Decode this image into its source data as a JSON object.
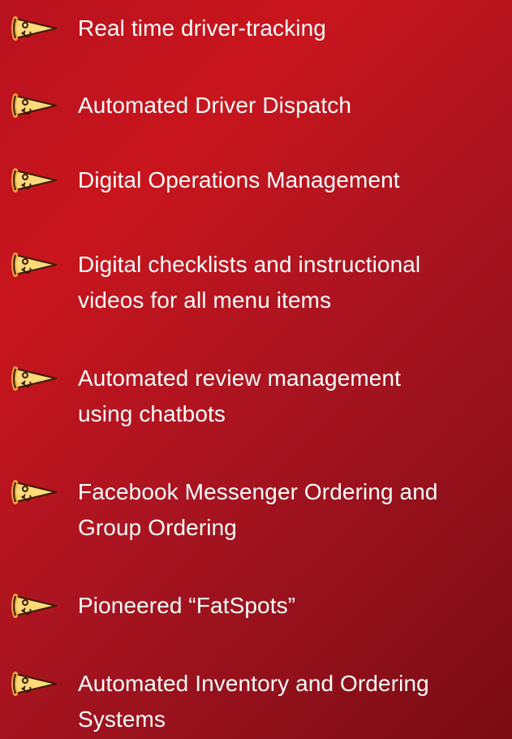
{
  "icon_name": "pizza-slice-icon",
  "colors": {
    "background_start": "#b8121f",
    "background_end": "#7a0c14",
    "text": "#ffffff",
    "icon_crust": "#f2a53a",
    "icon_cheese": "#ffd97a",
    "icon_outline": "#3a1a00"
  },
  "features": [
    {
      "lines": [
        "Real time driver-tracking"
      ]
    },
    {
      "lines": [
        "Automated Driver Dispatch"
      ]
    },
    {
      "lines": [
        "Digital Operations Management"
      ]
    },
    {
      "lines": [
        "Digital checklists and instructional",
        "videos for all menu items"
      ]
    },
    {
      "lines": [
        "Automated review management",
        "using chatbots"
      ]
    },
    {
      "lines": [
        "Facebook Messenger Ordering and",
        "Group Ordering"
      ]
    },
    {
      "lines": [
        "Pioneered “FatSpots”"
      ]
    },
    {
      "lines": [
        "Automated Inventory and Ordering",
        "Systems"
      ]
    }
  ]
}
